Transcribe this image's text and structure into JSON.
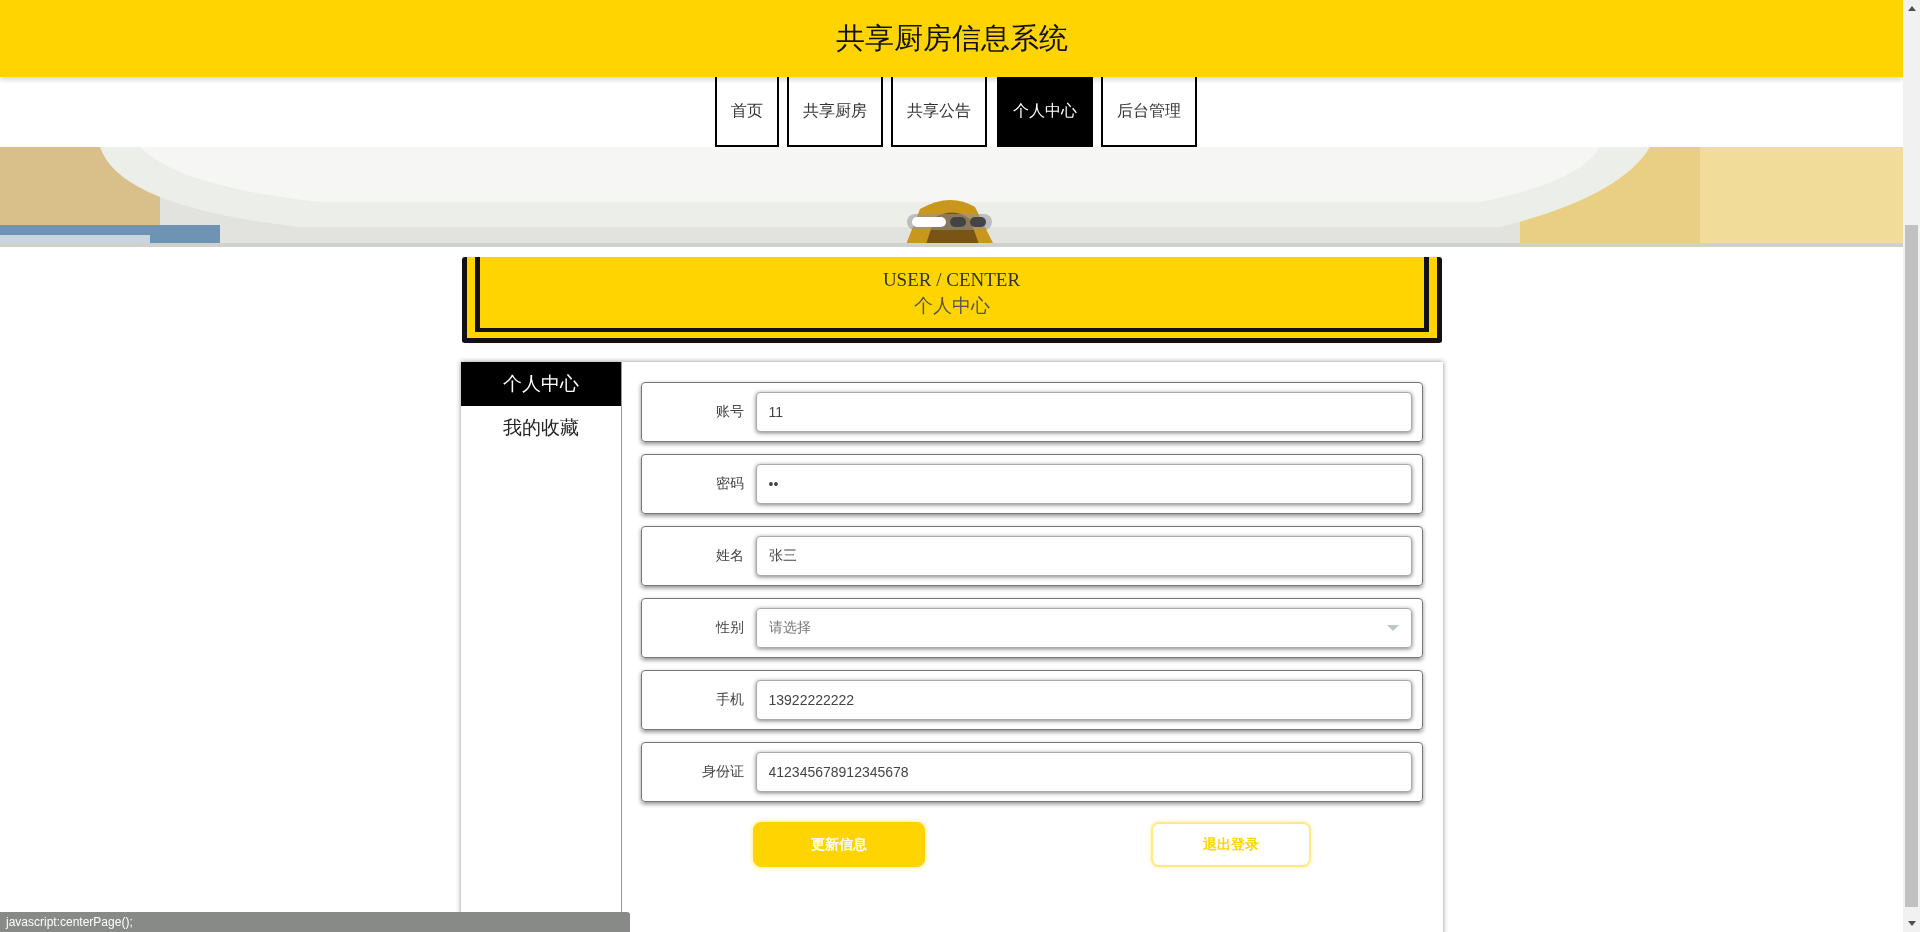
{
  "header": {
    "title": "共享厨房信息系统"
  },
  "nav": [
    {
      "label": "首页",
      "selected": false
    },
    {
      "label": "共享厨房",
      "selected": false
    },
    {
      "label": "共享公告",
      "selected": false
    },
    {
      "label": "个人中心",
      "selected": true
    },
    {
      "label": "后台管理",
      "selected": false
    }
  ],
  "banner": {
    "kind": "picture",
    "dots": [
      {
        "selected": true
      },
      {
        "selected": false
      },
      {
        "selected": false
      }
    ]
  },
  "section_title": {
    "english": "USER / CENTER",
    "chinese": "个人中心"
  },
  "sidebar": {
    "items": [
      {
        "label": "个人中心",
        "selected": true
      },
      {
        "label": "我的收藏",
        "selected": false
      }
    ]
  },
  "form": {
    "fields": [
      {
        "kind": "text",
        "label": "账号",
        "value": "11"
      },
      {
        "kind": "text",
        "label": "密码",
        "value": "••"
      },
      {
        "kind": "text",
        "label": "姓名",
        "value": "张三"
      },
      {
        "kind": "select",
        "label": "性别",
        "placeholder": "请选择"
      },
      {
        "kind": "text",
        "label": "手机",
        "value": "13922222222"
      },
      {
        "kind": "text",
        "label": "身份证",
        "value": "412345678912345678"
      }
    ],
    "buttons": [
      {
        "kind": "primary",
        "label": "更新信息"
      },
      {
        "kind": "outline",
        "label": "退出登录"
      }
    ]
  },
  "status_bar": {
    "text": "javascript:centerPage();"
  }
}
